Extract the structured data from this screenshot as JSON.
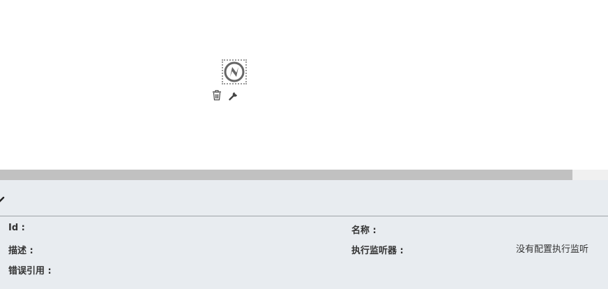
{
  "canvas": {
    "node_icon": "bolt-circle-icon",
    "tools": {
      "delete_icon": "trash-icon",
      "config_icon": "wrench-icon"
    }
  },
  "properties": {
    "fields": {
      "id": {
        "label": "Id :",
        "value": ""
      },
      "name": {
        "label": "名称 :",
        "value": ""
      },
      "description": {
        "label": "描述 :",
        "value": ""
      },
      "execution_listeners": {
        "label": "执行监听器 :",
        "value": "没有配置执行监听"
      },
      "error_ref": {
        "label": "错误引用 :",
        "value": ""
      }
    }
  },
  "colors": {
    "node_icon": "#666666",
    "panel_bg": "#e8ecf0",
    "scroll_thumb": "#c1c1c1"
  }
}
